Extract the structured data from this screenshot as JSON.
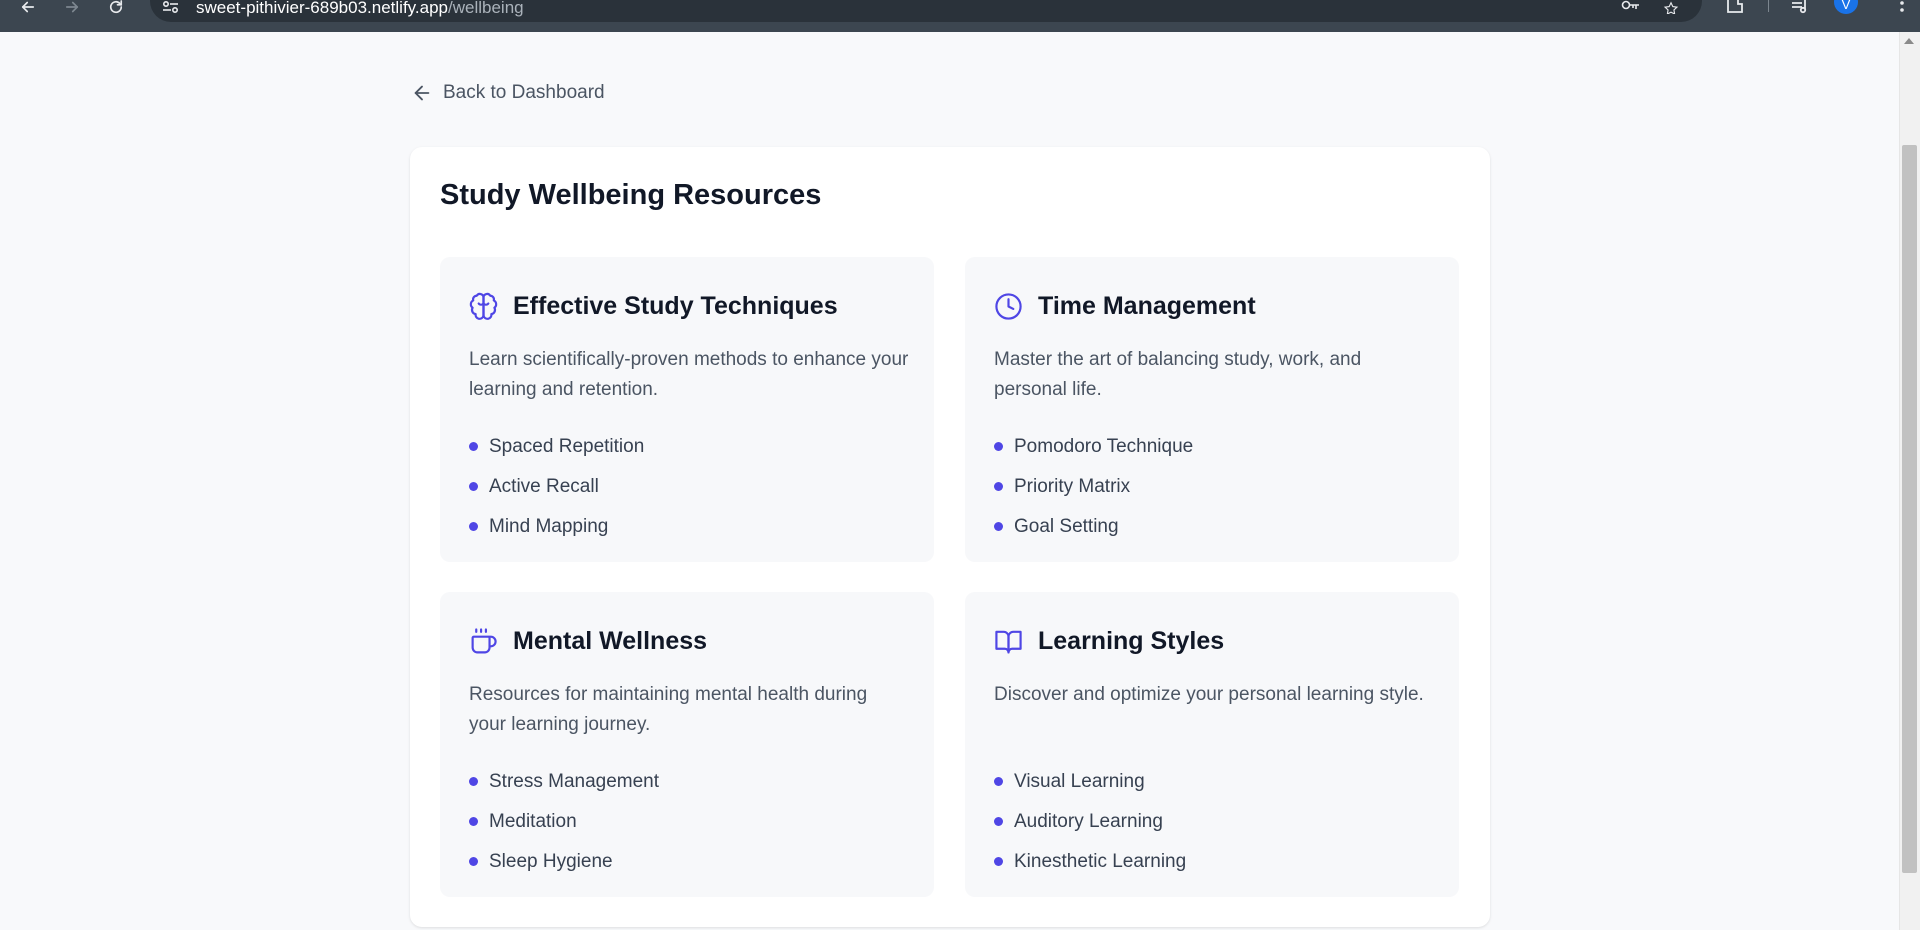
{
  "browser": {
    "url_domain": "sweet-pithivier-689b03.netlify.app",
    "url_path": "/wellbeing",
    "profile_initial": "V"
  },
  "nav": {
    "back_label": "Back to Dashboard"
  },
  "page": {
    "title": "Study Wellbeing Resources"
  },
  "accent_color": "#4f46e5",
  "cards": [
    {
      "icon": "brain-icon",
      "title": "Effective Study Techniques",
      "description": "Learn scientifically-proven methods to enhance your learning and retention.",
      "items": [
        "Spaced Repetition",
        "Active Recall",
        "Mind Mapping"
      ]
    },
    {
      "icon": "clock-icon",
      "title": "Time Management",
      "description": "Master the art of balancing study, work, and personal life.",
      "items": [
        "Pomodoro Technique",
        "Priority Matrix",
        "Goal Setting"
      ]
    },
    {
      "icon": "coffee-icon",
      "title": "Mental Wellness",
      "description": "Resources for maintaining mental health during your learning journey.",
      "items": [
        "Stress Management",
        "Meditation",
        "Sleep Hygiene"
      ]
    },
    {
      "icon": "book-open-icon",
      "title": "Learning Styles",
      "description": "Discover and optimize your personal learning style.",
      "items": [
        "Visual Learning",
        "Auditory Learning",
        "Kinesthetic Learning"
      ]
    }
  ]
}
